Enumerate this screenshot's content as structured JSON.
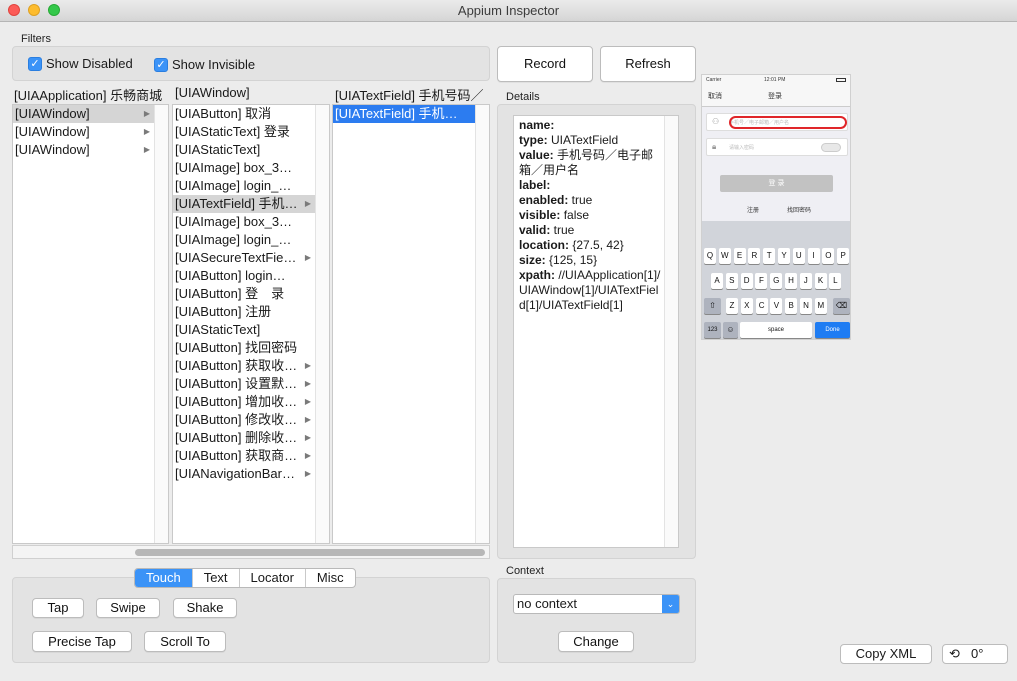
{
  "window": {
    "title": "Appium Inspector"
  },
  "filters": {
    "label": "Filters",
    "show_disabled": "Show Disabled",
    "show_invisible": "Show Invisible"
  },
  "actions": {
    "record": "Record",
    "refresh": "Refresh"
  },
  "columns": [
    {
      "header": "[UIAApplication] 乐畅商城",
      "items": [
        {
          "label": "[UIAWindow]",
          "selected": true,
          "has_children": true
        },
        {
          "label": "[UIAWindow]",
          "has_children": true
        },
        {
          "label": "[UIAWindow]",
          "has_children": true
        }
      ]
    },
    {
      "header": "[UIAWindow]",
      "items": [
        {
          "label": "[UIAButton] 取消"
        },
        {
          "label": "[UIAStaticText] 登录"
        },
        {
          "label": "[UIAStaticText]"
        },
        {
          "label": "[UIAImage] box_3…"
        },
        {
          "label": "[UIAImage] login_…"
        },
        {
          "label": "[UIATextField] 手机…",
          "selected": true,
          "has_children": true
        },
        {
          "label": "[UIAImage] box_3…"
        },
        {
          "label": "[UIAImage] login_…"
        },
        {
          "label": "[UIASecureTextFie…",
          "has_children": true
        },
        {
          "label": "[UIAButton] login…"
        },
        {
          "label": "[UIAButton] 登　录"
        },
        {
          "label": "[UIAButton] 注册"
        },
        {
          "label": "[UIAStaticText]"
        },
        {
          "label": "[UIAButton] 找回密码"
        },
        {
          "label": "[UIAButton] 获取收…",
          "has_children": true
        },
        {
          "label": "[UIAButton] 设置默…",
          "has_children": true
        },
        {
          "label": "[UIAButton] 增加收…",
          "has_children": true
        },
        {
          "label": "[UIAButton] 修改收…",
          "has_children": true
        },
        {
          "label": "[UIAButton] 删除收…",
          "has_children": true
        },
        {
          "label": "[UIAButton] 获取商…",
          "has_children": true
        },
        {
          "label": "[UIANavigationBar…",
          "has_children": true
        }
      ]
    },
    {
      "header": "[UIATextField] 手机号码／",
      "items": [
        {
          "label": "[UIATextField] 手机…",
          "selected": true
        }
      ]
    }
  ],
  "tabs": {
    "touch": "Touch",
    "text": "Text",
    "locator": "Locator",
    "misc": "Misc",
    "active": "Touch"
  },
  "touch_actions": {
    "tap": "Tap",
    "swipe": "Swipe",
    "shake": "Shake",
    "precise_tap": "Precise Tap",
    "scroll_to": "Scroll To"
  },
  "details": {
    "label": "Details",
    "fields": [
      {
        "key": "name:",
        "value": ""
      },
      {
        "key": "type:",
        "value": "UIATextField"
      },
      {
        "key": "value:",
        "value": "手机号码／电子邮箱／用户名"
      },
      {
        "key": "label:",
        "value": ""
      },
      {
        "key": "enabled:",
        "value": "true"
      },
      {
        "key": "visible:",
        "value": "false"
      },
      {
        "key": "valid:",
        "value": "true"
      },
      {
        "key": "location:",
        "value": "{27.5, 42}"
      },
      {
        "key": "size:",
        "value": "{125, 15}"
      },
      {
        "key": "xpath:",
        "value": "//UIAApplication[1]/UIAWindow[1]/UIATextField[1]/UIATextField[1]"
      }
    ]
  },
  "context": {
    "label": "Context",
    "selected": "no context",
    "change": "Change"
  },
  "phone": {
    "carrier": "Carrier",
    "time": "12:01 PM",
    "cancel": "取消",
    "title": "登录",
    "username_placeholder": "手机号／电子邮箱／用户名",
    "password_placeholder": "请输入密码",
    "login": "登 录",
    "register": "注册",
    "forgot": "找回密码",
    "keys_row1": [
      "Q",
      "W",
      "E",
      "R",
      "T",
      "Y",
      "U",
      "I",
      "O",
      "P"
    ],
    "keys_row2": [
      "A",
      "S",
      "D",
      "F",
      "G",
      "H",
      "J",
      "K",
      "L"
    ],
    "keys_row3": [
      "Z",
      "X",
      "C",
      "V",
      "B",
      "N",
      "M"
    ],
    "key_123": "123",
    "key_space": "space",
    "key_done": "Done"
  },
  "footer": {
    "copy_xml": "Copy XML",
    "rotation": "0°"
  },
  "colors": {
    "accent": "#3b93f7",
    "selection_blue": "#2c7cf0",
    "highlight_red": "#e0262a"
  }
}
